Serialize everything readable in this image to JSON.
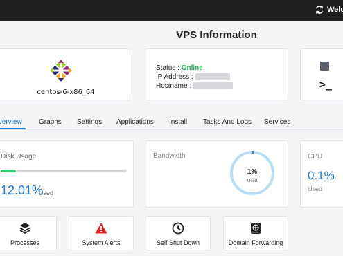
{
  "topbar": {
    "welcome_text": "Welco"
  },
  "page_title": "VPS Information",
  "os": {
    "name": "centos-6-x86_64"
  },
  "status": {
    "status_label": "Status :",
    "status_value": "Online",
    "ip_label": "IP Address :",
    "hostname_label": "Hostname :",
    "status_color": "#1db954"
  },
  "console": {
    "prompt_glyph": ">_"
  },
  "tabs": [
    {
      "label": "Overview",
      "active": true
    },
    {
      "label": "Graphs"
    },
    {
      "label": "Settings"
    },
    {
      "label": "Applications"
    },
    {
      "label": "Install"
    },
    {
      "label": "Tasks And Logs"
    },
    {
      "label": "Services"
    }
  ],
  "disk": {
    "title": "Disk Usage",
    "percent": "12.01%",
    "used_label": "Used",
    "fill_fraction": 0.1201,
    "bar_color": "#2ecc71"
  },
  "bandwidth": {
    "title": "Bandwidth",
    "percent": "1%",
    "used_label": "Used",
    "fill_fraction": 0.01
  },
  "cpu": {
    "title": "CPU",
    "percent": "0.1%",
    "used_label": "Used"
  },
  "tiles": [
    {
      "label": "Processes",
      "icon": "layers-icon"
    },
    {
      "label": "System Alerts",
      "icon": "warning-icon"
    },
    {
      "label": "Self Shut Down",
      "icon": "clock-icon"
    },
    {
      "label": "Domain Forwarding",
      "icon": "globe-book-icon"
    }
  ],
  "colors": {
    "accent": "#1e7bd6",
    "topbar": "#1f1f1f",
    "alert": "#e02424"
  }
}
